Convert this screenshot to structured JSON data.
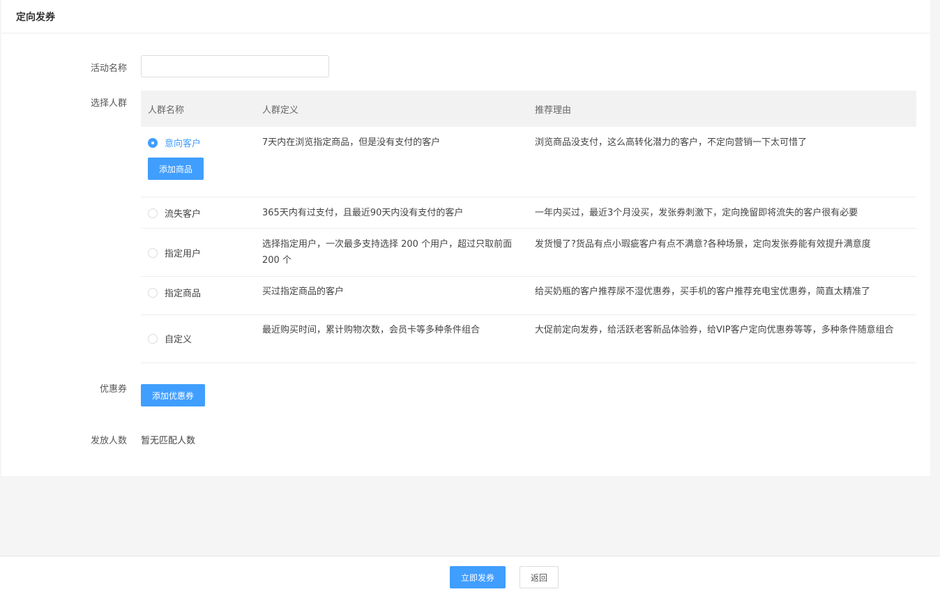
{
  "header": {
    "title": "定向发券"
  },
  "form": {
    "activity_name_label": "活动名称",
    "activity_name_value": "",
    "activity_name_placeholder": "",
    "audience_label": "选择人群",
    "coupon_label": "优惠券",
    "coupon_button": "添加优惠券",
    "recipients_label": "发放人数",
    "recipients_value": "暂无匹配人数"
  },
  "table": {
    "headers": [
      "人群名称",
      "人群定义",
      "推荐理由"
    ],
    "rows": [
      {
        "name": "意向客户",
        "selected": true,
        "definition": "7天内在浏览指定商品，但是没有支付的客户",
        "reason": "浏览商品没支付，这么高转化潜力的客户，不定向营销一下太可惜了",
        "action": "添加商品"
      },
      {
        "name": "流失客户",
        "selected": false,
        "definition": "365天内有过支付，且最近90天内没有支付的客户",
        "reason": "一年内买过，最近3个月没买，发张券刺激下，定向挽留即将流失的客户很有必要"
      },
      {
        "name": "指定用户",
        "selected": false,
        "definition": "选择指定用户，一次最多支持选择 200 个用户，超过只取前面 200 个",
        "reason": "发货慢了?货品有点小瑕疵客户有点不满意?各种场景，定向发张券能有效提升满意度"
      },
      {
        "name": "指定商品",
        "selected": false,
        "definition": "买过指定商品的客户",
        "reason": "给买奶瓶的客户推荐尿不湿优惠券，买手机的客户推荐充电宝优惠券，简直太精准了"
      },
      {
        "name": "自定义",
        "selected": false,
        "definition": "最近购买时间，累计购物次数，会员卡等多种条件组合",
        "reason": "大促前定向发券，给活跃老客新品体验券，给VIP客户定向优惠券等等，多种条件随意组合"
      }
    ]
  },
  "footer": {
    "submit": "立即发券",
    "back": "返回"
  },
  "colors": {
    "accent": "#409eff"
  }
}
